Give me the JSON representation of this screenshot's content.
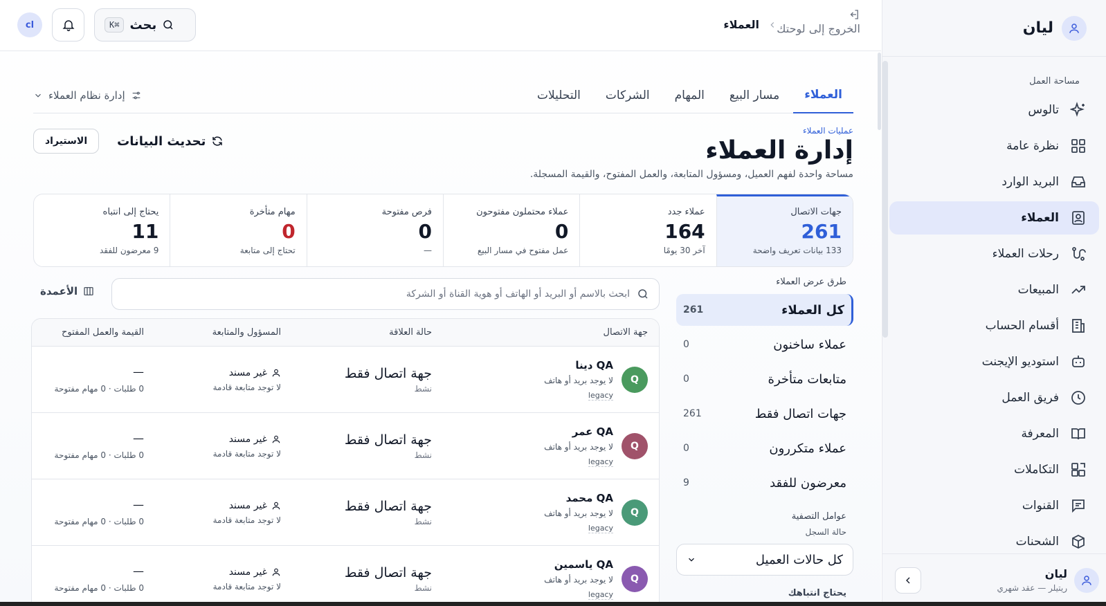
{
  "sidebar": {
    "brand": "ليان",
    "section_label": "مساحة العمل",
    "items": [
      {
        "label": "تالوس",
        "icon": "sparkles-icon"
      },
      {
        "label": "نظرة عامة",
        "icon": "grid-icon"
      },
      {
        "label": "البريد الوارد",
        "icon": "inbox-icon"
      },
      {
        "label": "العملاء",
        "icon": "contacts-icon",
        "active": true
      },
      {
        "label": "رحلات العملاء",
        "icon": "route-icon"
      },
      {
        "label": "المبيعات",
        "icon": "trend-up-icon"
      },
      {
        "label": "أقسام الحساب",
        "icon": "building-icon"
      },
      {
        "label": "استوديو الإيجنت",
        "icon": "bot-icon"
      },
      {
        "label": "فريق العمل",
        "icon": "history-icon"
      },
      {
        "label": "المعرفة",
        "icon": "book-icon"
      },
      {
        "label": "التكاملات",
        "icon": "puzzle-icon"
      },
      {
        "label": "القنوات",
        "icon": "message-icon"
      },
      {
        "label": "الشحنات",
        "icon": "box-icon"
      }
    ],
    "footer": {
      "name": "ليان",
      "plan": "ريتيلر — عقد شهري"
    }
  },
  "topbar": {
    "exit_label": "الخروج إلى لوحتك",
    "breadcrumb": "العملاء",
    "search_label": "بحث",
    "search_shortcut": "⌘K",
    "user_initials": "cl"
  },
  "tabs": [
    {
      "label": "العملاء",
      "active": true
    },
    {
      "label": "مسار البيع"
    },
    {
      "label": "المهام"
    },
    {
      "label": "الشركات"
    },
    {
      "label": "التحليلات"
    }
  ],
  "manage_label": "إدارة نظام العملاء",
  "header": {
    "eyebrow": "عمليات العملاء",
    "title": "إدارة العملاء",
    "subtitle": "مساحة واحدة لفهم العميل، ومسؤول المتابعة، والعمل المفتوح، والقيمة المسجلة."
  },
  "actions": {
    "refresh": "تحديث البيانات",
    "import": "الاستيراد"
  },
  "stats": [
    {
      "label": "جهات الاتصال",
      "value": "261",
      "note": "133 بيانات تعريف واضحة",
      "active": true
    },
    {
      "label": "عملاء جدد",
      "value": "164",
      "note": "آخر 30 يومًا"
    },
    {
      "label": "عملاء محتملون مفتوحون",
      "value": "0",
      "note": "عمل مفتوح في مسار البيع"
    },
    {
      "label": "فرص مفتوحة",
      "value": "0",
      "note": "—"
    },
    {
      "label": "مهام متأخرة",
      "value": "0",
      "note": "تحتاج إلى متابعة",
      "alert": true
    },
    {
      "label": "يحتاج إلى انتباه",
      "value": "11",
      "note": "9 معرضون للفقد"
    }
  ],
  "views": {
    "title": "طرق عرض العملاء",
    "items": [
      {
        "label": "كل العملاء",
        "count": "261",
        "active": true
      },
      {
        "label": "عملاء ساخنون",
        "count": "0"
      },
      {
        "label": "متابعات متأخرة",
        "count": "0"
      },
      {
        "label": "جهات اتصال فقط",
        "count": "261"
      },
      {
        "label": "عملاء متكررون",
        "count": "0"
      },
      {
        "label": "معرضون للفقد",
        "count": "9"
      }
    ]
  },
  "filters": {
    "title": "عوامل التصفية",
    "record_status_label": "حالة السجل",
    "status_select": "كل حالات العميل",
    "needs_attention": "يحتاج انتباهك"
  },
  "list": {
    "search_placeholder": "ابحث بالاسم أو البريد أو الهاتف أو هوية القناة أو الشركة",
    "columns_label": "الأعمدة",
    "headers": [
      "جهة الاتصال",
      "حالة العلاقة",
      "المسؤول والمتابعة",
      "القيمة والعمل المفتوح"
    ],
    "rows": [
      {
        "initial": "Q",
        "color": "#4a9a5e",
        "name": "QA دينا",
        "email": "لا يوجد بريد أو هاتف",
        "tag": "legacy",
        "relation": "جهة اتصال فقط",
        "relation_sub": "نشط",
        "owner": "غير مسند",
        "owner_sub": "لا توجد متابعة قادمة",
        "value": "—",
        "value_sub": "0 طلبات · 0 مهام مفتوحة"
      },
      {
        "initial": "Q",
        "color": "#a0526a",
        "name": "QA عمر",
        "email": "لا يوجد بريد أو هاتف",
        "tag": "legacy",
        "relation": "جهة اتصال فقط",
        "relation_sub": "نشط",
        "owner": "غير مسند",
        "owner_sub": "لا توجد متابعة قادمة",
        "value": "—",
        "value_sub": "0 طلبات · 0 مهام مفتوحة"
      },
      {
        "initial": "Q",
        "color": "#4a9a78",
        "name": "QA محمد",
        "email": "لا يوجد بريد أو هاتف",
        "tag": "legacy",
        "relation": "جهة اتصال فقط",
        "relation_sub": "نشط",
        "owner": "غير مسند",
        "owner_sub": "لا توجد متابعة قادمة",
        "value": "—",
        "value_sub": "0 طلبات · 0 مهام مفتوحة"
      },
      {
        "initial": "Q",
        "color": "#8a5ab0",
        "name": "QA ياسمين",
        "email": "لا يوجد بريد أو هاتف",
        "tag": "legacy",
        "relation": "جهة اتصال فقط",
        "relation_sub": "نشط",
        "owner": "غير مسند",
        "owner_sub": "لا توجد متابعة قادمة",
        "value": "—",
        "value_sub": "0 طلبات · 0 مهام مفتوحة"
      }
    ]
  }
}
